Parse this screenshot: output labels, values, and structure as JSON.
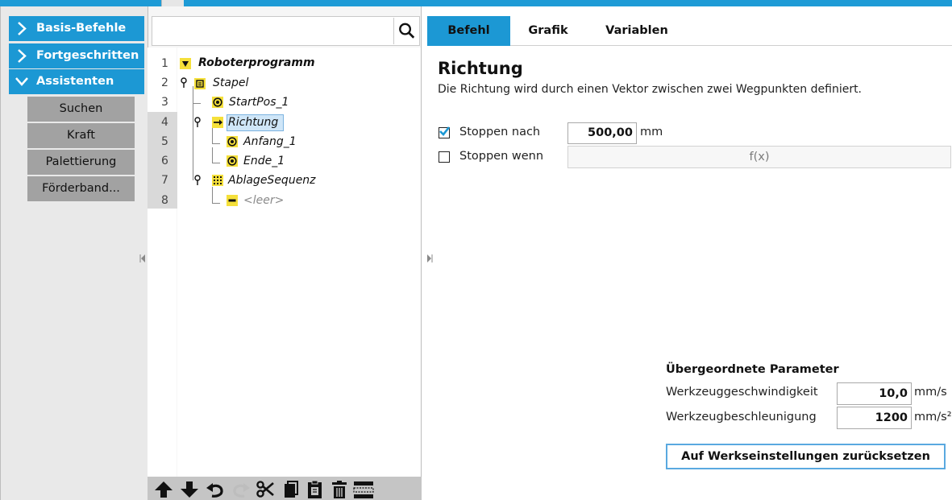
{
  "nav": {
    "categories": [
      {
        "label": "Basis-Befehle",
        "expanded": false
      },
      {
        "label": "Fortgeschritten",
        "expanded": false
      },
      {
        "label": "Assistenten",
        "expanded": true
      }
    ],
    "sub_items": [
      "Suchen",
      "Kraft",
      "Palettierung",
      "Förderband..."
    ]
  },
  "tree": {
    "search_placeholder": "",
    "line_numbers": [
      "1",
      "2",
      "3",
      "4",
      "5",
      "6",
      "7",
      "8"
    ],
    "nodes": [
      {
        "label": "Roboterprogramm",
        "icon": "program-icon"
      },
      {
        "label": "Stapel",
        "icon": "stack-icon"
      },
      {
        "label": "StartPos_1",
        "icon": "waypoint-icon"
      },
      {
        "label": "Richtung",
        "icon": "direction-arrow-icon",
        "selected": true
      },
      {
        "label": "Anfang_1",
        "icon": "waypoint-icon"
      },
      {
        "label": "Ende_1",
        "icon": "waypoint-icon"
      },
      {
        "label": "AblageSequenz",
        "icon": "sequence-icon"
      },
      {
        "label": "<leer>",
        "icon": "empty-icon"
      }
    ],
    "toolbar_icons": [
      "move-up-icon",
      "move-down-icon",
      "undo-icon",
      "redo-icon",
      "cut-icon",
      "copy-icon",
      "paste-icon",
      "delete-icon",
      "suppress-icon"
    ]
  },
  "tabs": [
    {
      "label": "Befehl",
      "active": true
    },
    {
      "label": "Grafik",
      "active": false
    },
    {
      "label": "Variablen",
      "active": false
    }
  ],
  "command": {
    "title": "Richtung",
    "description": "Die Richtung wird durch einen Vektor zwischen zwei Wegpunkten definiert.",
    "stop_after_label": "Stoppen nach",
    "stop_after_checked": true,
    "stop_after_value": "500,00",
    "stop_after_unit": "mm",
    "stop_when_label": "Stoppen wenn",
    "stop_when_checked": false,
    "stop_when_expr": "f(x)"
  },
  "params": {
    "heading": "Übergeordnete Parameter",
    "speed_label": "Werkzeuggeschwindigkeit",
    "speed_value": "10,0",
    "speed_unit": "mm/s",
    "accel_label": "Werkzeugbeschleunigung",
    "accel_value": "1200",
    "accel_unit": "mm/s²",
    "reset_label": "Auf Werkseinstellungen zurücksetzen"
  },
  "colors": {
    "accent": "#1c98d4",
    "node_yellow": "#f5e03a",
    "selection": "#cfe6f8"
  }
}
